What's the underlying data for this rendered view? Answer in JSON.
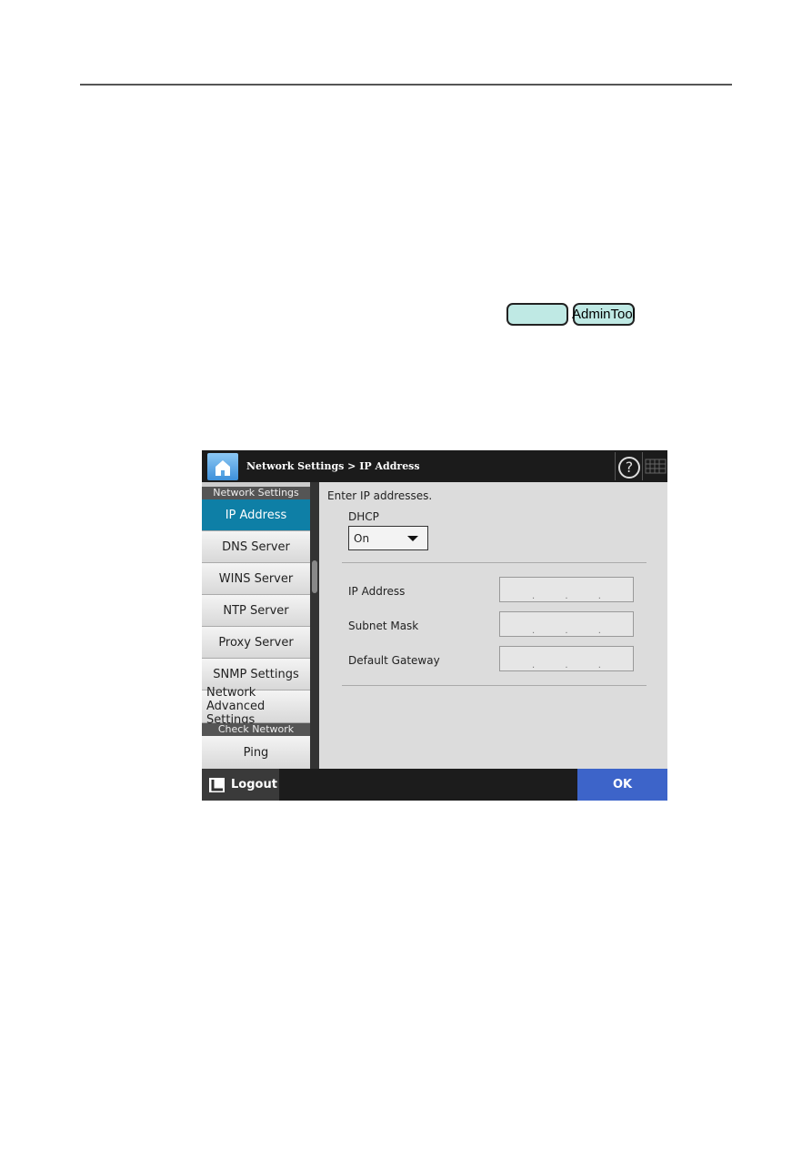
{
  "badges": [
    {
      "label": ""
    },
    {
      "label": "AdminTool"
    }
  ],
  "screen": {
    "breadcrumb": "Network Settings > IP Address",
    "help_icon": "?",
    "sidebar": {
      "group1": "Network Settings",
      "items": [
        "IP Address",
        "DNS Server",
        "WINS Server",
        "NTP Server",
        "Proxy Server",
        "SNMP Settings",
        "Network Advanced Settings"
      ],
      "group2": "Check Network Status",
      "items2": [
        "Ping"
      ],
      "selected": "IP Address"
    },
    "content": {
      "instruction": "Enter IP addresses.",
      "dhcp_label": "DHCP",
      "dhcp_value": "On",
      "fields": [
        {
          "label": "IP Address",
          "value": ". . ."
        },
        {
          "label": "Subnet Mask",
          "value": ". . ."
        },
        {
          "label": "Default Gateway",
          "value": ". . ."
        }
      ]
    },
    "footer": {
      "logout": "Logout",
      "ok": "OK"
    },
    "colors": {
      "selected": "#0e7fa6",
      "ok": "#3d64c9",
      "badge": "#bfe9e4"
    }
  }
}
